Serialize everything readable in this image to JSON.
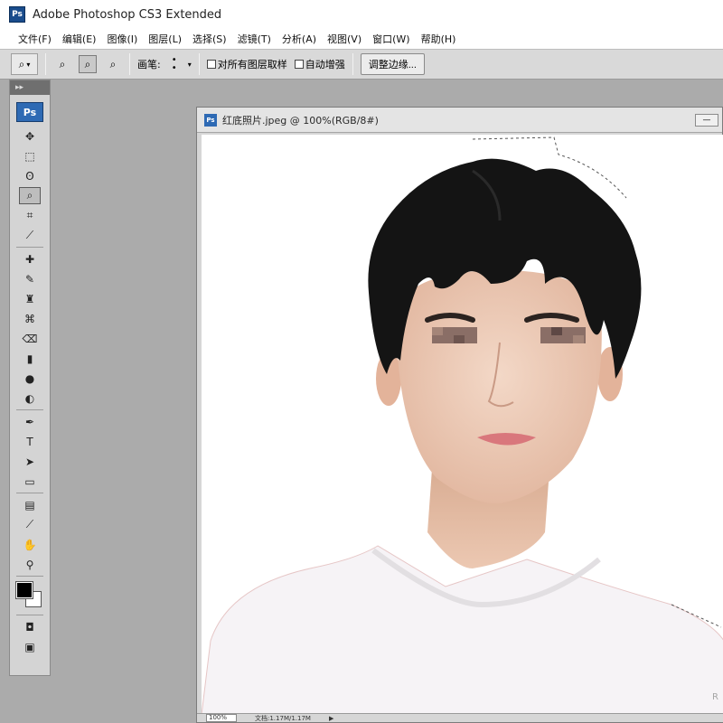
{
  "window": {
    "title": "Adobe Photoshop CS3 Extended",
    "app_icon": "Ps"
  },
  "menu": [
    {
      "label": "文件(F)"
    },
    {
      "label": "编辑(E)"
    },
    {
      "label": "图像(I)"
    },
    {
      "label": "图层(L)"
    },
    {
      "label": "选择(S)"
    },
    {
      "label": "滤镜(T)"
    },
    {
      "label": "分析(A)"
    },
    {
      "label": "视图(V)"
    },
    {
      "label": "窗口(W)"
    },
    {
      "label": "帮助(H)"
    }
  ],
  "options": {
    "brush_label": "画笔:",
    "sample_all_layers": "对所有图层取样",
    "auto_enhance": "自动增强",
    "refine_edge_button": "调整边缘..."
  },
  "tools": {
    "logo": "Ps",
    "items": [
      {
        "name": "move",
        "icon": "move-icon",
        "glyph": "✥"
      },
      {
        "name": "marquee",
        "icon": "marquee-icon",
        "glyph": "⬚"
      },
      {
        "name": "lasso",
        "icon": "lasso-icon",
        "glyph": "ʘ"
      },
      {
        "name": "quick-selection",
        "icon": "quick-selection-icon",
        "glyph": "⌕",
        "active": true
      },
      {
        "name": "crop",
        "icon": "crop-icon",
        "glyph": "⌗"
      },
      {
        "name": "slice",
        "icon": "slice-icon",
        "glyph": "⟋"
      },
      {
        "name": "spot-healing",
        "icon": "bandage-icon",
        "glyph": "✚"
      },
      {
        "name": "brush",
        "icon": "brush-icon",
        "glyph": "✎"
      },
      {
        "name": "clone-stamp",
        "icon": "stamp-icon",
        "glyph": "♜"
      },
      {
        "name": "history-brush",
        "icon": "history-brush-icon",
        "glyph": "⌘"
      },
      {
        "name": "eraser",
        "icon": "eraser-icon",
        "glyph": "⌫"
      },
      {
        "name": "gradient",
        "icon": "gradient-icon",
        "glyph": "▮"
      },
      {
        "name": "blur",
        "icon": "blur-icon",
        "glyph": "●"
      },
      {
        "name": "dodge",
        "icon": "dodge-icon",
        "glyph": "◐"
      },
      {
        "name": "pen",
        "icon": "pen-icon",
        "glyph": "✒"
      },
      {
        "name": "type",
        "icon": "type-icon",
        "glyph": "T"
      },
      {
        "name": "path-selection",
        "icon": "arrow-icon",
        "glyph": "➤"
      },
      {
        "name": "shape",
        "icon": "rectangle-icon",
        "glyph": "▭"
      },
      {
        "name": "notes",
        "icon": "notes-icon",
        "glyph": "▤"
      },
      {
        "name": "eyedropper",
        "icon": "eyedropper-icon",
        "glyph": "⟋"
      },
      {
        "name": "hand",
        "icon": "hand-icon",
        "glyph": "✋"
      },
      {
        "name": "zoom",
        "icon": "zoom-icon",
        "glyph": "⚲"
      }
    ]
  },
  "document": {
    "title": "红底照片.jpeg @ 100%(RGB/8#)",
    "zoom": "100%",
    "doc_info": "文档:1.17M/1.17M"
  },
  "colors": {
    "foreground": "#000000",
    "background": "#ffffff",
    "shirt": "#f6f3f6",
    "hair": "#141414",
    "skin": "#efd0bd"
  },
  "watermark": "R"
}
